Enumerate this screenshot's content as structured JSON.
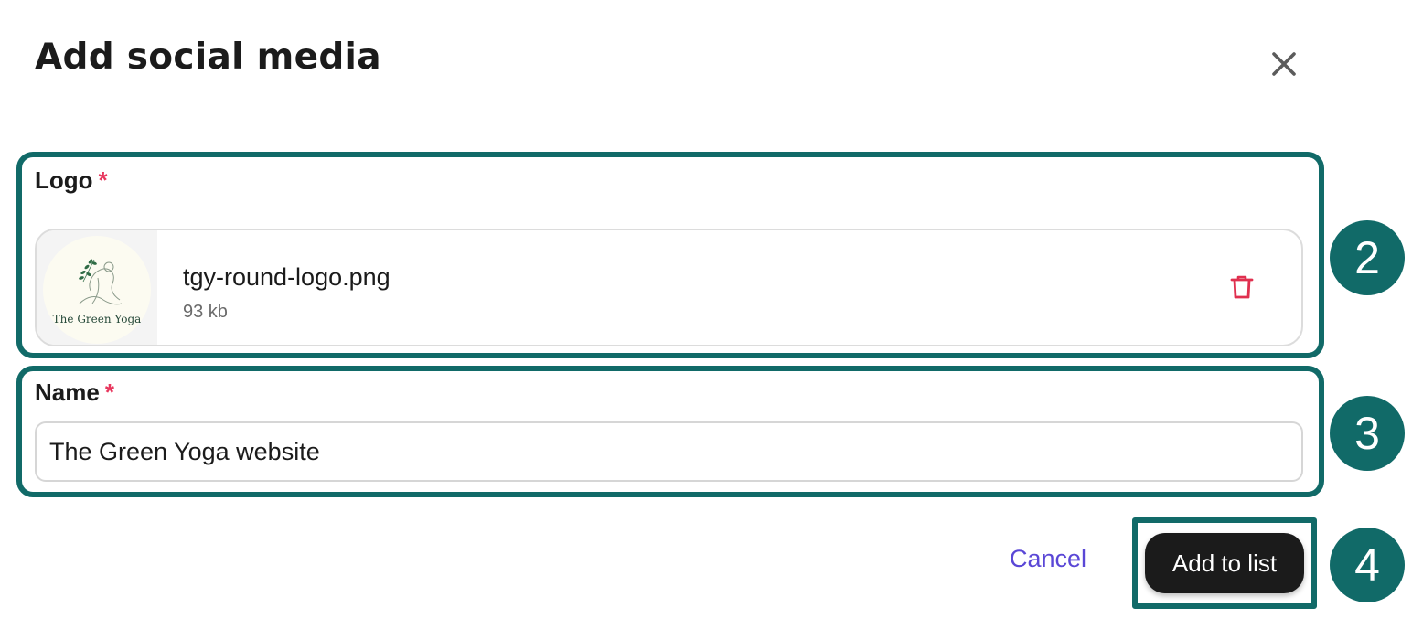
{
  "dialog": {
    "title": "Add social media",
    "close_icon": "close-icon"
  },
  "logo_field": {
    "label": "Logo",
    "required_mark": "*",
    "file": {
      "name": "tgy-round-logo.png",
      "size": "93 kb",
      "thumbnail_text": "The Green Yoga",
      "delete_icon": "trash-icon"
    }
  },
  "name_field": {
    "label": "Name",
    "required_mark": "*",
    "value": "The Green Yoga website"
  },
  "actions": {
    "cancel_label": "Cancel",
    "submit_label": "Add to list"
  },
  "step_badges": [
    "2",
    "3",
    "4"
  ],
  "colors": {
    "highlight": "#116a68",
    "required": "#e8365d",
    "link": "#5a47d6",
    "primary_button": "#1b1b1b",
    "delete": "#e0304f"
  }
}
